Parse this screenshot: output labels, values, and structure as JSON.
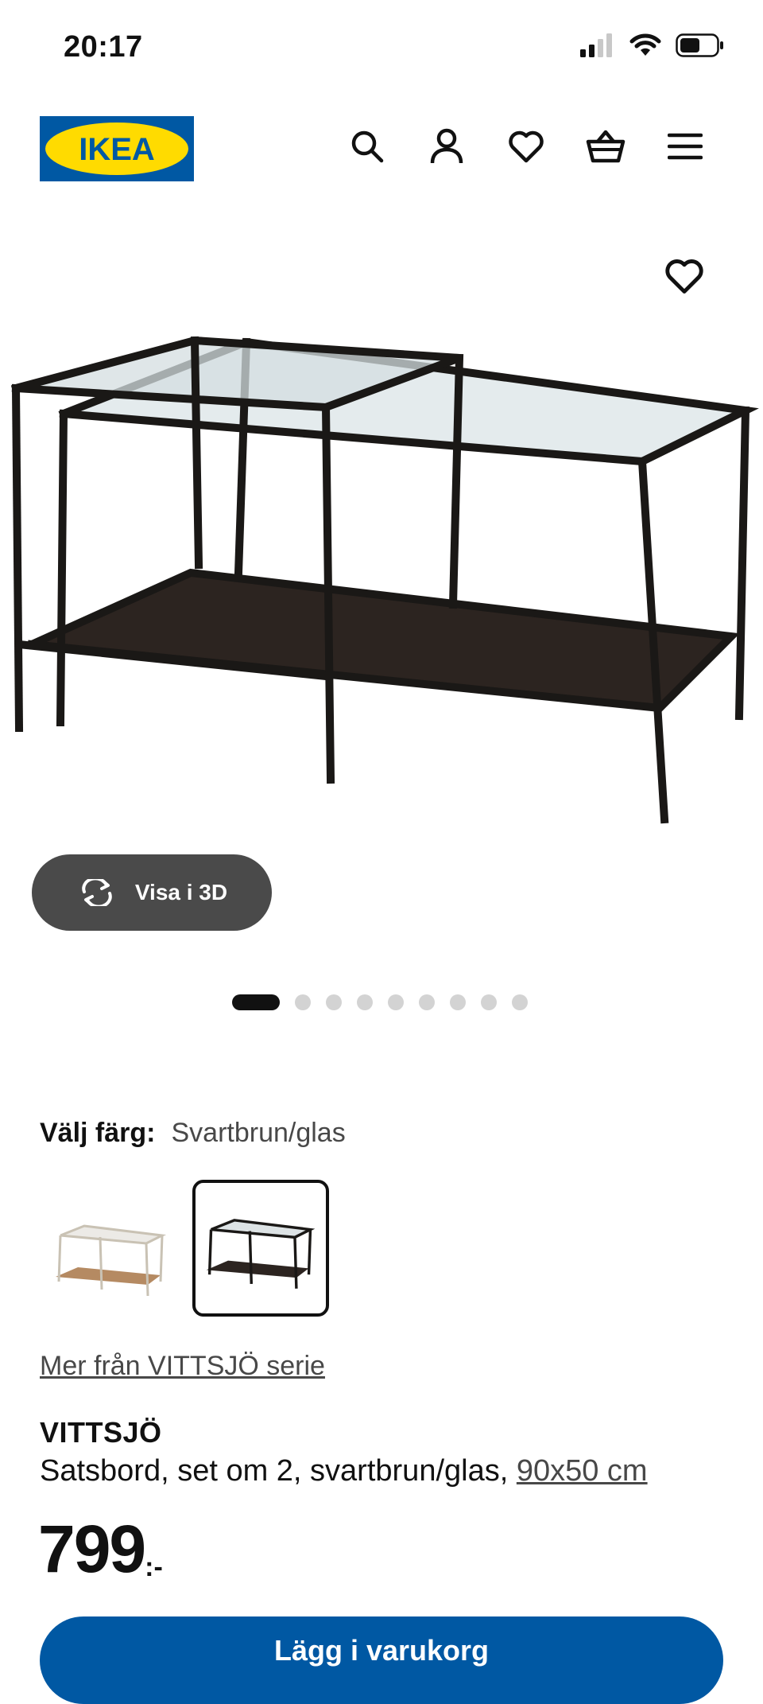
{
  "status_bar": {
    "time": "20:17"
  },
  "header": {
    "logo_text": "IKEA",
    "icons": [
      "search-icon",
      "user-icon",
      "heart-icon",
      "basket-icon",
      "menu-icon"
    ]
  },
  "product_image": {
    "view_3d_label": "Visa i 3D",
    "image_count": 9,
    "active_index": 0
  },
  "color": {
    "label": "Välj färg:",
    "selected": "Svartbrun/glas"
  },
  "series_link": "Mer från VITTSJÖ serie",
  "product": {
    "name": "VITTSJÖ",
    "description": "Satsbord, set om 2, svartbrun/glas, ",
    "size": "90x50 cm",
    "price": "799",
    "price_suffix": ":-"
  },
  "buy_button": {
    "label": "Lägg i varukorg"
  },
  "colors": {
    "brand_blue": "#0058a3",
    "brand_yellow": "#ffdb00",
    "button_dark": "#4a4a4a"
  }
}
